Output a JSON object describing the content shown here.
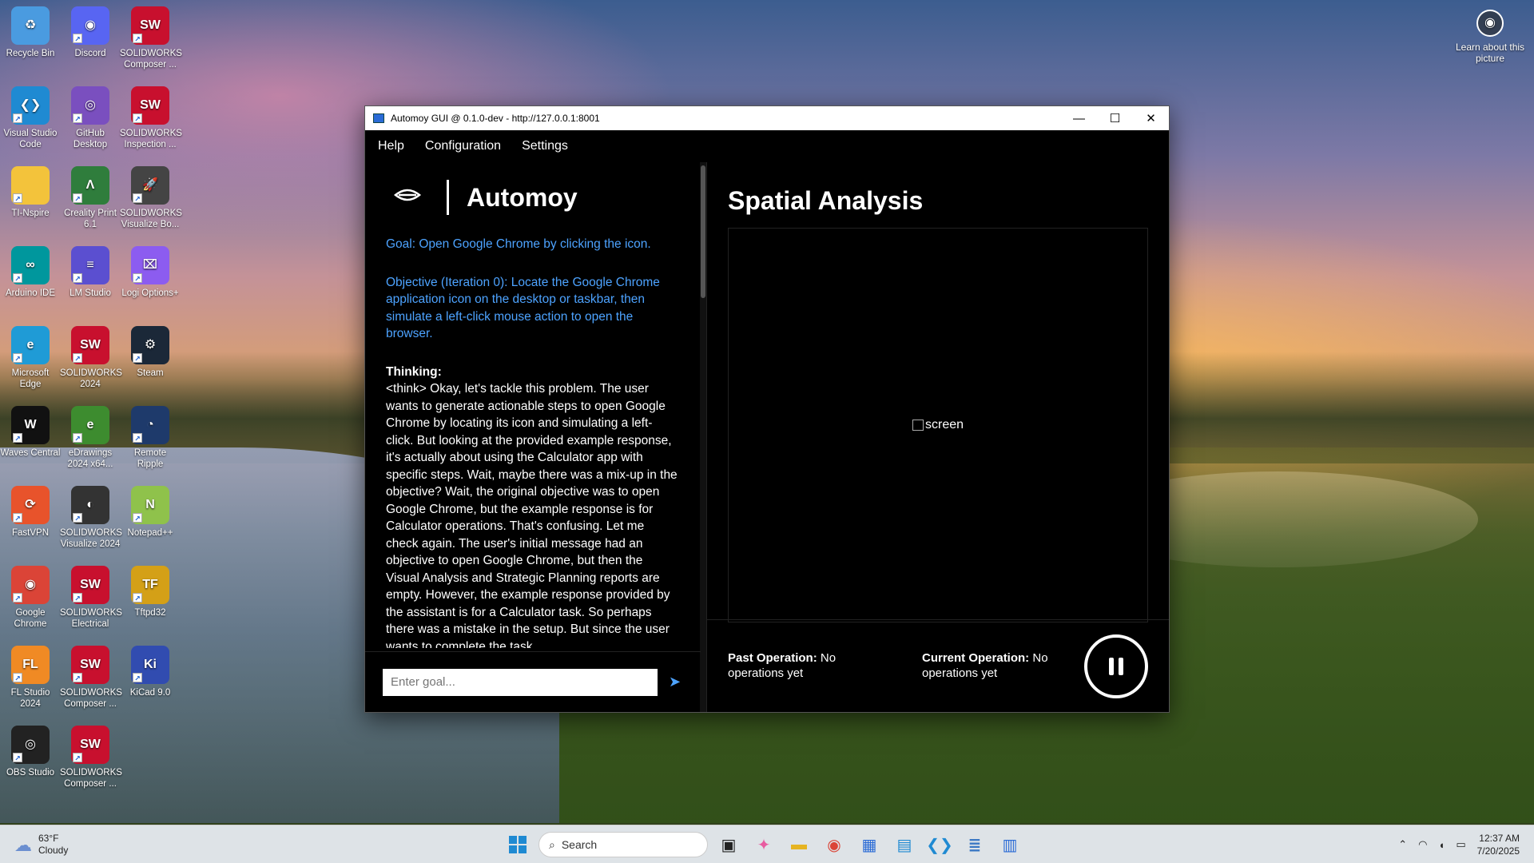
{
  "desktop": {
    "icons": [
      {
        "label": "Recycle Bin",
        "icon": "recycle-bin-icon",
        "color": "#4a9be0",
        "glyph": "♻"
      },
      {
        "label": "Discord",
        "icon": "discord-icon",
        "color": "#5865f2",
        "glyph": "◉"
      },
      {
        "label": "SOLIDWORKS Composer ...",
        "icon": "solidworks-composer-icon",
        "color": "#c8102e",
        "glyph": "SW"
      },
      {
        "label": "Visual Studio Code",
        "icon": "vscode-icon",
        "color": "#1f8ad2",
        "glyph": "❮❯"
      },
      {
        "label": "GitHub Desktop",
        "icon": "github-desktop-icon",
        "color": "#7a4fbf",
        "glyph": "◎"
      },
      {
        "label": "SOLIDWORKS Inspection ...",
        "icon": "solidworks-inspection-icon",
        "color": "#c8102e",
        "glyph": "SW"
      },
      {
        "label": "TI-Nspire",
        "icon": "folder-icon",
        "color": "#f3c33b",
        "glyph": ""
      },
      {
        "label": "Creality Print 6.1",
        "icon": "creality-print-icon",
        "color": "#2f7d3c",
        "glyph": "Λ"
      },
      {
        "label": "SOLIDWORKS Visualize Bo...",
        "icon": "solidworks-visualize-boost-icon",
        "color": "#444",
        "glyph": "🚀"
      },
      {
        "label": "Arduino IDE",
        "icon": "arduino-icon",
        "color": "#00979d",
        "glyph": "∞"
      },
      {
        "label": "LM Studio",
        "icon": "lm-studio-icon",
        "color": "#5b4fd0",
        "glyph": "≡"
      },
      {
        "label": "Logi Options+",
        "icon": "logi-options-icon",
        "color": "#8c5cf0",
        "glyph": "⌧"
      },
      {
        "label": "Microsoft Edge",
        "icon": "edge-icon",
        "color": "#1f9bd6",
        "glyph": "e"
      },
      {
        "label": "SOLIDWORKS 2024",
        "icon": "solidworks-icon",
        "color": "#c8102e",
        "glyph": "SW"
      },
      {
        "label": "Steam",
        "icon": "steam-icon",
        "color": "#1b2838",
        "glyph": "⚙"
      },
      {
        "label": "Waves Central",
        "icon": "waves-central-icon",
        "color": "#111",
        "glyph": "W"
      },
      {
        "label": "eDrawings 2024 x64...",
        "icon": "edrawings-icon",
        "color": "#3d8c2f",
        "glyph": "e"
      },
      {
        "label": "Remote Ripple",
        "icon": "remote-ripple-icon",
        "color": "#1e3a6b",
        "glyph": "◔"
      },
      {
        "label": "FastVPN",
        "icon": "fastvpn-icon",
        "color": "#e8532b",
        "glyph": "⟳"
      },
      {
        "label": "SOLIDWORKS Visualize 2024",
        "icon": "solidworks-visualize-icon",
        "color": "#333",
        "glyph": "◐"
      },
      {
        "label": "Notepad++",
        "icon": "notepadpp-icon",
        "color": "#8fc24b",
        "glyph": "N"
      },
      {
        "label": "Google Chrome",
        "icon": "chrome-icon",
        "color": "#db4437",
        "glyph": "◉"
      },
      {
        "label": "SOLIDWORKS Electrical",
        "icon": "solidworks-electrical-icon",
        "color": "#c8102e",
        "glyph": "SW"
      },
      {
        "label": "Tftpd32",
        "icon": "tftpd32-icon",
        "color": "#d4a017",
        "glyph": "TF"
      },
      {
        "label": "FL Studio 2024",
        "icon": "fl-studio-icon",
        "color": "#f08a24",
        "glyph": "FL"
      },
      {
        "label": "SOLIDWORKS Composer ...",
        "icon": "solidworks-composer-icon",
        "color": "#c8102e",
        "glyph": "SW"
      },
      {
        "label": "KiCad 9.0",
        "icon": "kicad-icon",
        "color": "#314cb0",
        "glyph": "Ki"
      },
      {
        "label": "OBS Studio",
        "icon": "obs-icon",
        "color": "#222",
        "glyph": "◎"
      },
      {
        "label": "SOLIDWORKS Composer ...",
        "icon": "solidworks-composer-icon",
        "color": "#c8102e",
        "glyph": "SW"
      }
    ],
    "learn_label": "Learn about this picture"
  },
  "window": {
    "title": "Automoy GUI @ 0.1.0-dev - http://127.0.0.1:8001",
    "menu": [
      "Help",
      "Configuration",
      "Settings"
    ],
    "brand": "Automoy",
    "goal": "Goal: Open Google Chrome by clicking the icon.",
    "objective": "Objective (Iteration 0): Locate the Google Chrome application icon on the desktop or taskbar, then simulate a left-click mouse action to open the browser.",
    "thinking_label": "Thinking:",
    "thinking_text": "<think> Okay, let's tackle this problem. The user wants to generate actionable steps to open Google Chrome by locating its icon and simulating a left-click. But looking at the provided example response, it's actually about using the Calculator app with specific steps. Wait, maybe there was a mix-up in the objective? Wait, the original objective was to open Google Chrome, but the example response is for Calculator operations. That's confusing. Let me check again. The user's initial message had an objective to open Google Chrome, but then the Visual Analysis and Strategic Planning reports are empty. However, the example response provided by the assistant is for a Calculator task. So perhaps there was a mistake in the setup. But since the user wants to complete the task...",
    "input_placeholder": "Enter goal...",
    "spatial_title": "Spatial Analysis",
    "screen_alt": "screen",
    "past_op_label": "Past Operation:",
    "past_op_value": "No operations yet",
    "current_op_label": "Current Operation:",
    "current_op_value": "No operations yet"
  },
  "taskbar": {
    "temperature": "63°F",
    "condition": "Cloudy",
    "search_label": "Search",
    "time": "12:37 AM",
    "date": "7/20/2025",
    "apps": [
      {
        "icon": "task-view-icon",
        "color": "#222",
        "glyph": "▣"
      },
      {
        "icon": "copilot-icon",
        "color": "#e85ca0",
        "glyph": "✦"
      },
      {
        "icon": "file-explorer-icon",
        "color": "#e6b422",
        "glyph": "▬"
      },
      {
        "icon": "chrome-icon",
        "color": "#db4437",
        "glyph": "◉"
      },
      {
        "icon": "store-icon",
        "color": "#2a6bd6",
        "glyph": "▦"
      },
      {
        "icon": "photos-icon",
        "color": "#1f8ad2",
        "glyph": "▤"
      },
      {
        "icon": "vscode-icon",
        "color": "#1f8ad2",
        "glyph": "❮❯"
      },
      {
        "icon": "notepad-icon",
        "color": "#3b78c4",
        "glyph": "≣"
      },
      {
        "icon": "automoy-icon",
        "color": "#2a6bd6",
        "glyph": "▥"
      }
    ]
  }
}
